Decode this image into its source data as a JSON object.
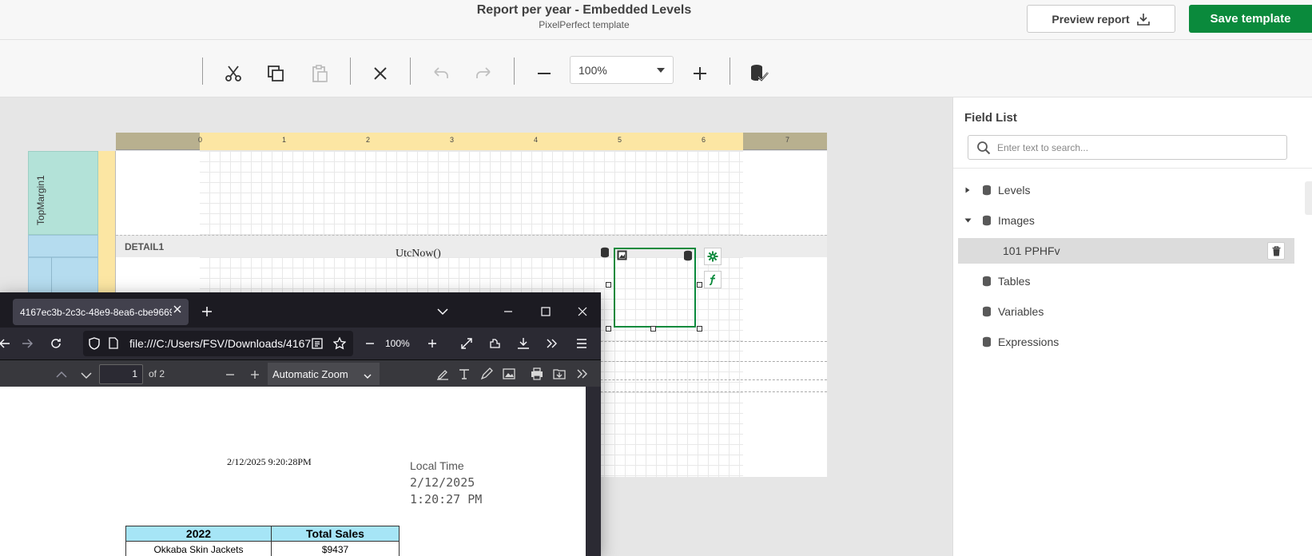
{
  "header": {
    "title": "Report per year - Embedded Levels",
    "subtitle": "PixelPerfect template",
    "preview_label": "Preview report",
    "save_label": "Save template"
  },
  "toolbar": {
    "zoom_value": "100%",
    "icons": [
      "cut-icon",
      "copy-icon",
      "paste-icon",
      "delete-icon",
      "undo-icon",
      "redo-icon",
      "zoom-out-icon",
      "zoom-in-icon",
      "validate-icon"
    ]
  },
  "designer": {
    "ruler_numbers": [
      "0",
      "1",
      "2",
      "3",
      "4",
      "5",
      "6",
      "7"
    ],
    "top_margin_label": "TopMargin1",
    "detail_label": "DETAIL1",
    "utc_expression": "UtcNow()"
  },
  "field_list": {
    "title": "Field List",
    "search_placeholder": "Enter text to search...",
    "items": [
      {
        "label": "Levels",
        "expanded": false
      },
      {
        "label": "Images",
        "expanded": true
      },
      {
        "label": "101 PPHFv",
        "selected": true
      },
      {
        "label": "Tables"
      },
      {
        "label": "Variables"
      },
      {
        "label": "Expressions"
      }
    ]
  },
  "browser": {
    "tab_title": "4167ec3b-2c3c-48e9-8ea6-cbe9669",
    "url": "file:///C:/Users/FSV/Downloads/4167",
    "zoom": "100%",
    "page_number": "1",
    "page_total": "of 2",
    "zoom_mode": "Automatic Zoom"
  },
  "pdf": {
    "utc_date": "2/12/2025 9:20:28PM",
    "local_time_label": "Local Time",
    "local_date": "2/12/2025",
    "local_time": "1:20:27 PM",
    "table_headers": [
      "2022",
      "Total Sales"
    ],
    "table_rows": [
      [
        "Okkaba Skin Jackets",
        "$9437"
      ]
    ]
  },
  "colors": {
    "brand_green": "#0a8a3c",
    "ruler_yellow": "#fce6a3",
    "band_teal": "#b3e2d8",
    "band_blue": "#b5dcef",
    "table_header": "#a6e5f6"
  }
}
